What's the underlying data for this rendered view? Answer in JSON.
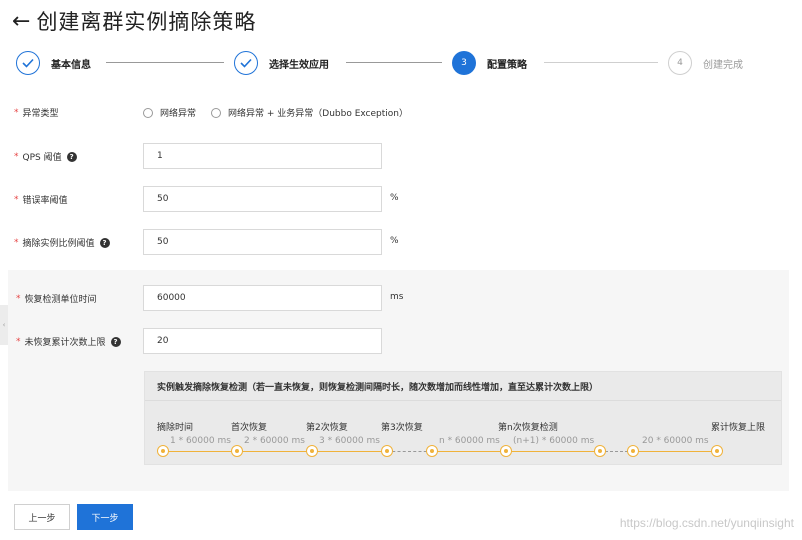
{
  "page": {
    "title": "创建离群实例摘除策略",
    "back_icon": "←"
  },
  "steps": [
    {
      "number": "1",
      "label": "基本信息",
      "state": "done"
    },
    {
      "number": "2",
      "label": "选择生效应用",
      "state": "done"
    },
    {
      "number": "3",
      "label": "配置策略",
      "state": "active"
    },
    {
      "number": "4",
      "label": "创建完成",
      "state": "todo"
    }
  ],
  "form": {
    "exception_type": {
      "label": "异常类型",
      "options": [
        "网络异常",
        "网络异常 + 业务异常（Dubbo Exception）"
      ]
    },
    "qps_threshold": {
      "label": "QPS 阈值",
      "value": "1"
    },
    "error_rate": {
      "label": "错误率阈值",
      "value": "50",
      "unit": "%"
    },
    "remove_ratio": {
      "label": "摘除实例比例阈值",
      "value": "50",
      "unit": "%"
    },
    "recovery_unit": {
      "label": "恢复检测单位时间",
      "value": "60000",
      "unit": "ms"
    },
    "max_recovery": {
      "label": "未恢复累计次数上限",
      "value": "20"
    }
  },
  "timeline": {
    "heading": "实例触发摘除恢复检测（若一直未恢复，则恢复检测间隔时长，随次数增加而线性增加，直至达累计次数上限）",
    "labels": [
      "摘除时间",
      "首次恢复",
      "第2次恢复",
      "第3次恢复",
      "第n次恢复检测",
      "累计恢复上限"
    ],
    "intervals": [
      "1 * 60000 ms",
      "2 * 60000 ms",
      "3 * 60000 ms",
      "n * 60000 ms",
      "(n+1) * 60000 ms",
      "20 * 60000 ms"
    ],
    "accent_color": "#f0b23a"
  },
  "buttons": {
    "prev": "上一步",
    "next": "下一步"
  },
  "watermark": "https://blog.csdn.net/yunqiinsight",
  "colors": {
    "primary": "#1f73d8",
    "required": "#e64545"
  }
}
